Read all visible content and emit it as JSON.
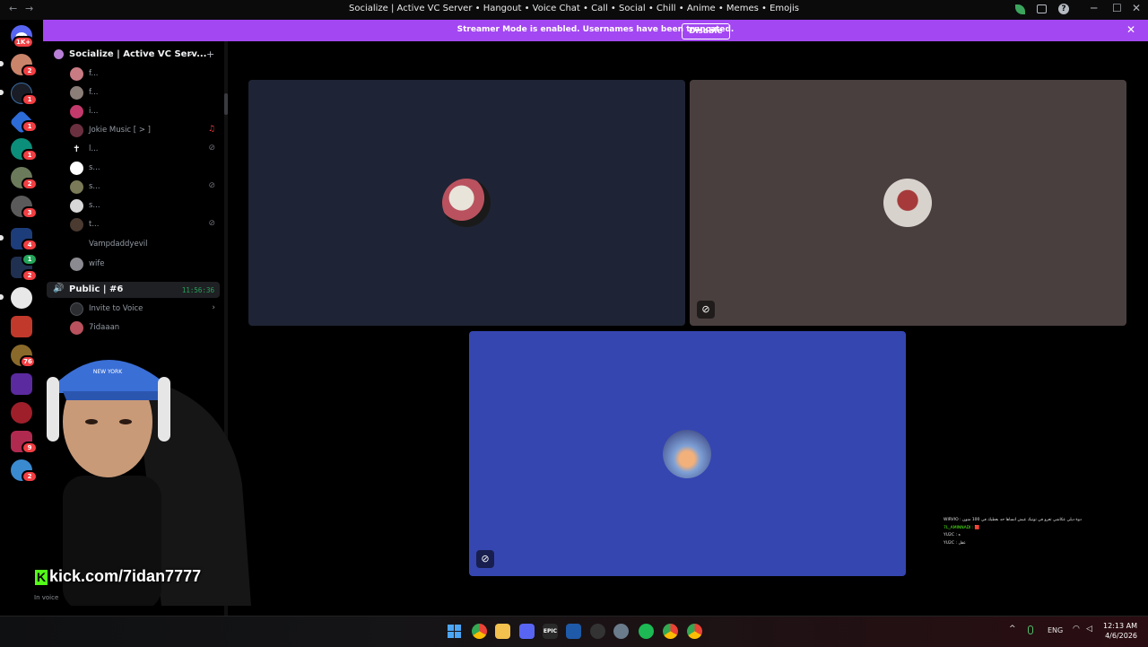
{
  "window": {
    "title": "Socialize | Active VC Server • Hangout • Voice Chat • Call • Social • Chill • Anime • Memes • Emojis",
    "back": "←",
    "forward": "→",
    "minimize": "─",
    "maximize": "☐",
    "close": "✕"
  },
  "server_rail": {
    "home_badge": "1K+",
    "badges": [
      "2",
      "1",
      "1",
      "1",
      "2",
      "3",
      "4",
      "1",
      "2",
      "76",
      "9",
      "2"
    ]
  },
  "banner": {
    "message": "Streamer Mode is enabled. Usernames have been truncated.",
    "disable_label": "Disable",
    "close": "✕"
  },
  "server": {
    "name": "Socialize | Active VC Serv...",
    "chevron": "⌄",
    "add_user": "+"
  },
  "members": [
    {
      "name": "f...",
      "color": "#c97b84"
    },
    {
      "name": "f...",
      "color": "#8b7e78"
    },
    {
      "name": "i...",
      "color": "#c23a6b"
    },
    {
      "name": "Jokie Music [ > ]",
      "color": "#6a3040",
      "icon": "♫"
    },
    {
      "name": "l...",
      "color": "#000000",
      "glyph": "✝",
      "icon": "⊘"
    },
    {
      "name": "s...",
      "color": "#ffffff"
    },
    {
      "name": "s...",
      "color": "#7a7a58",
      "icon": "⊘"
    },
    {
      "name": "s...",
      "color": "#d8d8d8"
    },
    {
      "name": "t...",
      "color": "#4a3a30",
      "icon": "⊘"
    },
    {
      "name": "Vampdaddyevil",
      "color": "#000000"
    },
    {
      "name": "wife",
      "color": "#8a8a90"
    }
  ],
  "voice_channel": {
    "name": "Public | #6",
    "timer": "11:56:36",
    "invite_label": "Invite to Voice",
    "invite_arrow": "›",
    "members": [
      {
        "name": "7idaaan",
        "color": "#b9525e"
      }
    ]
  },
  "stage": {
    "tiles": [
      {
        "bg": "#1e2435",
        "avatar": "#b9525e",
        "muted": false
      },
      {
        "bg": "#4a3f3f",
        "avatar": "#a63a3a",
        "muted": true
      },
      {
        "bg": "#3546b0",
        "avatar": "#7fa1d6",
        "muted": true
      }
    ],
    "mute_icon": "⊘"
  },
  "chat_overlay": {
    "lines": [
      "WIRVIO : دوة ديلي عكاشي تعرو في تونيك عيش انساها حد بعطيك في 100 منون",
      "7L_AMINNADI : 🟥",
      "YU2C : ه",
      "YU2C : عقل"
    ]
  },
  "stream": {
    "kick_logo": "K",
    "kick_url": "kick.com/7idan7777",
    "in_voice": "In voice"
  },
  "taskbar": {
    "tray_chevron": "^",
    "lang": "ENG",
    "time": "12:13 AM",
    "date": "4/6/2026"
  }
}
